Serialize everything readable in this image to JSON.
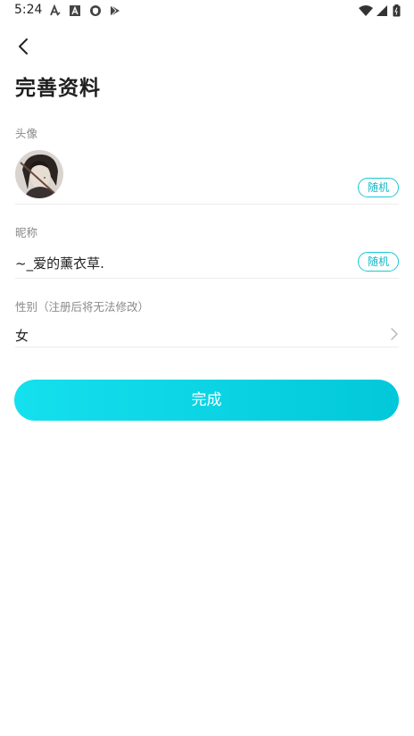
{
  "status_bar": {
    "time": "5:24",
    "left_icons": [
      "a-font-icon",
      "a-box-icon",
      "shield-icon",
      "play-store-icon"
    ],
    "right_icons": [
      "wifi-icon",
      "signal-icon",
      "battery-icon"
    ]
  },
  "header": {
    "back_icon": "chevron-left-icon",
    "title": "完善资料"
  },
  "avatar_section": {
    "label": "头像",
    "random_label": "随机"
  },
  "nickname_section": {
    "label": "昵称",
    "value": "~_爱的薰衣草.",
    "random_label": "随机"
  },
  "gender_section": {
    "label": "性别（注册后将无法修改）",
    "value": "女"
  },
  "submit": {
    "label": "完成"
  },
  "colors": {
    "accent": "#12b8c7",
    "button_gradient_start": "#15e0ee",
    "button_gradient_end": "#02c8da"
  }
}
